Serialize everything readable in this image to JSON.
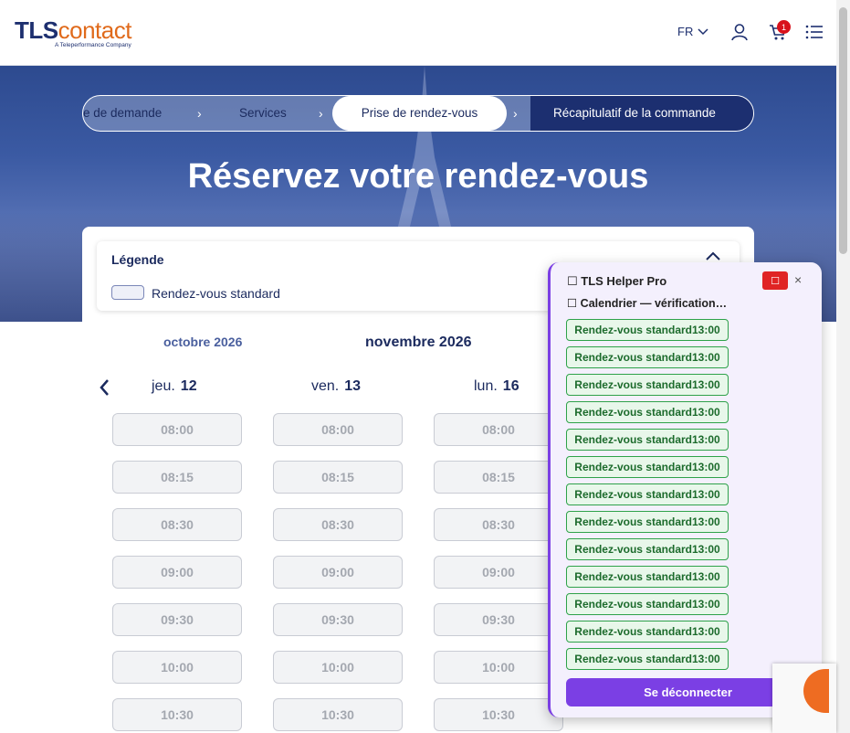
{
  "header": {
    "logo_tls": "TLS",
    "logo_contact": "contact",
    "logo_tagline": "A Teleperformance Company",
    "lang": "FR",
    "cart_count": "1"
  },
  "stepper": {
    "steps": [
      "e de demande",
      "Services",
      "Prise de rendez-vous",
      "Récapitulatif de la commande"
    ],
    "chevron": "›"
  },
  "hero": {
    "title": "Réservez votre rendez-vous"
  },
  "legend": {
    "title": "Légende",
    "item": "Rendez-vous standard"
  },
  "calendar": {
    "prev_month": "octobre 2026",
    "current_month": "novembre 2026",
    "days": [
      {
        "name": "jeu.",
        "num": "12"
      },
      {
        "name": "ven.",
        "num": "13"
      },
      {
        "name": "lun.",
        "num": "16"
      }
    ],
    "times": [
      "08:00",
      "08:15",
      "08:30",
      "09:00",
      "09:30",
      "10:00",
      "10:30"
    ]
  },
  "helper": {
    "title": "☐ TLS Helper Pro",
    "status": "☐ Calendrier — vérification…",
    "stop_icon": "☐",
    "close": "×",
    "slot_label": "Rendez-vous standard13:00",
    "slot_count": 13,
    "logout": "Se déconnecter",
    "colors": {
      "accent": "#7b3fe4",
      "slot_border": "#2fa24a",
      "stop": "#e02424"
    }
  }
}
